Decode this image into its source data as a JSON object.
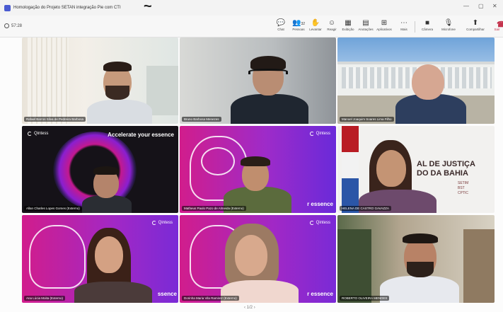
{
  "window": {
    "title": "Homologação do Projeto SETAN integração Pie com CTI",
    "overlay_glyph": "~",
    "minimize": "—",
    "maximize": "▢",
    "close": "✕"
  },
  "toolbar": {
    "timer": "57:28",
    "items": [
      {
        "icon": "chat-icon",
        "glyph": "💬",
        "label": "Chat"
      },
      {
        "icon": "people-icon",
        "glyph": "👥",
        "label": "Pessoas",
        "count": "32"
      },
      {
        "icon": "raise-hand-icon",
        "glyph": "✋",
        "label": "Levantar"
      },
      {
        "icon": "react-icon",
        "glyph": "☺",
        "label": "Reagir"
      },
      {
        "icon": "view-icon",
        "glyph": "▦",
        "label": "Exibição"
      },
      {
        "icon": "notes-icon",
        "glyph": "▤",
        "label": "Anotações"
      },
      {
        "icon": "apps-icon",
        "glyph": "⊞",
        "label": "Aplicativos"
      },
      {
        "icon": "more-icon",
        "glyph": "⋯",
        "label": "Mais"
      },
      {
        "icon": "camera-icon",
        "glyph": "■",
        "label": "Câmera"
      },
      {
        "icon": "microphone-icon",
        "glyph": "🎙",
        "label": "Microfone"
      },
      {
        "icon": "share-icon",
        "glyph": "⬆",
        "label": "Compartilhar"
      }
    ],
    "leave_label": "Sair"
  },
  "participants": [
    {
      "name": "Rafael Barros Silva de Pedreira Barbosa"
    },
    {
      "name": "Bruno Barbosa Menezes"
    },
    {
      "name": "Manoel Joaquim Soares Lima Filho"
    },
    {
      "name": "Allan Charles Lopes Gomes (Externo)"
    },
    {
      "name": "Matheus Paulo Pazo de Almeida (Externo)"
    },
    {
      "name": "HELENA DE CASTRO GAVAZZA"
    },
    {
      "name": "Ana Lúcia Moita (Externo)"
    },
    {
      "name": "Dorinha Maria Vila Ramirez (Externo)"
    },
    {
      "name": "ROBERTO OLIVEIRA MENDES"
    }
  ],
  "backgrounds": {
    "brand": "Qintess",
    "tagline_full": "Accelerate your essence",
    "tagline_partial_1": "r essence",
    "tagline_partial_2": "ssence",
    "court_text": "AL DE JUSTIÇA\nDO DA BAHIA",
    "court_small": "SETIM\nBST\nCPTIC"
  },
  "pager": "1/2",
  "colors": {
    "accent": "#4a5bd1",
    "leave": "#c4314b",
    "magenta": "#d1168a",
    "purple": "#6a2ad9"
  }
}
